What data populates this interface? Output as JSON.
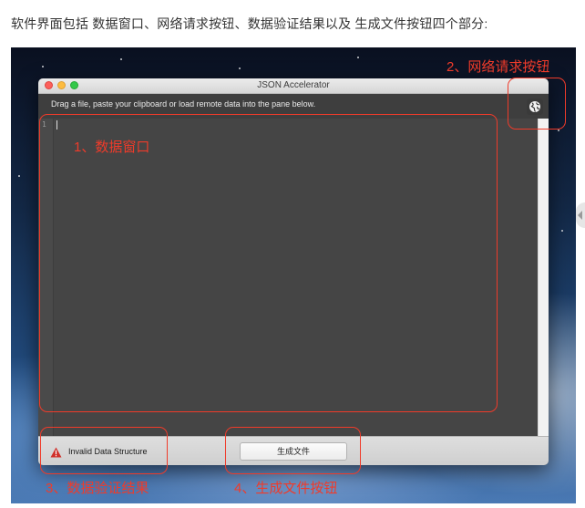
{
  "intro_text": "软件界面包括  数据窗口、网络请求按钮、数据验证结果以及 生成文件按钮四个部分:",
  "window": {
    "title": "JSON Accelerator",
    "instruction": "Drag a file, paste your clipboard or load remote data into the pane below.",
    "network_button_icon": "globe-icon",
    "editor": {
      "line_number": "1"
    },
    "status": {
      "icon": "warning-icon",
      "text": "Invalid Data Structure",
      "color": "#d0302a"
    },
    "generate_button_label": "生成文件"
  },
  "annotations": {
    "color": "#ef3b2a",
    "data_window": "1、数据窗口",
    "network_button": "2、网络请求按钮",
    "validation_result": "3、数据验证结果",
    "generate_button": "4、生成文件按钮"
  }
}
